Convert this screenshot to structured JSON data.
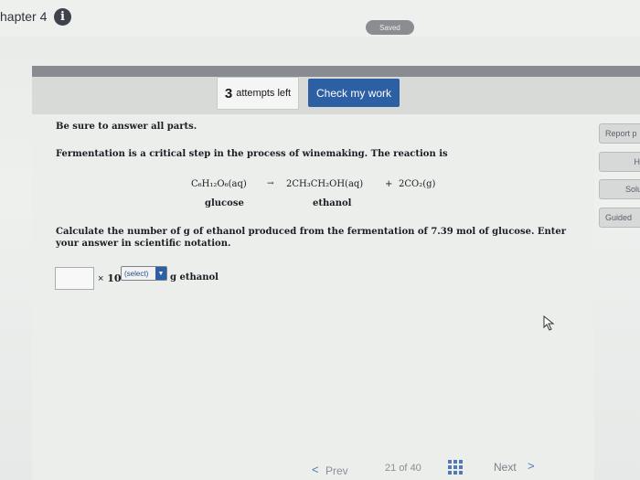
{
  "header": {
    "chapter_label": "hapter 4",
    "info_icon": "i",
    "saved_badge": "Saved"
  },
  "toolbar": {
    "attempts_count": "3",
    "attempts_text": "attempts left",
    "check_button": "Check my work"
  },
  "question": {
    "instruction": "Be sure to answer all parts.",
    "intro": "Fermentation is a critical step in the process of winemaking. The reaction is",
    "equation": {
      "reactant": "C₆H₁₂O₆(aq)",
      "arrow": "→",
      "product1": "2CH₃CH₂OH(aq)",
      "plus": "+",
      "product2": "2CO₂(g)"
    },
    "label_glucose": "glucose",
    "label_ethanol": "ethanol",
    "prompt": "Calculate the number of g of ethanol produced from the fermentation of 7.39 mol of glucose. Enter your answer in scientific notation."
  },
  "answer": {
    "input_value": "",
    "times_sign": "×",
    "base": "10",
    "exponent_select": "(select)",
    "unit": "g ethanol"
  },
  "side_buttons": {
    "report": "Report p",
    "hint": "Hi",
    "solution": "Solu",
    "guided": "Guided"
  },
  "nav": {
    "prev_arrow": "<",
    "prev": "Prev",
    "current_page": "21",
    "of_text": "of",
    "total_pages": "40",
    "next": "Next",
    "next_arrow": ">"
  },
  "colors": {
    "accent": "#2c5fa4",
    "header_band": "#888b90",
    "background": "#eceeec"
  }
}
